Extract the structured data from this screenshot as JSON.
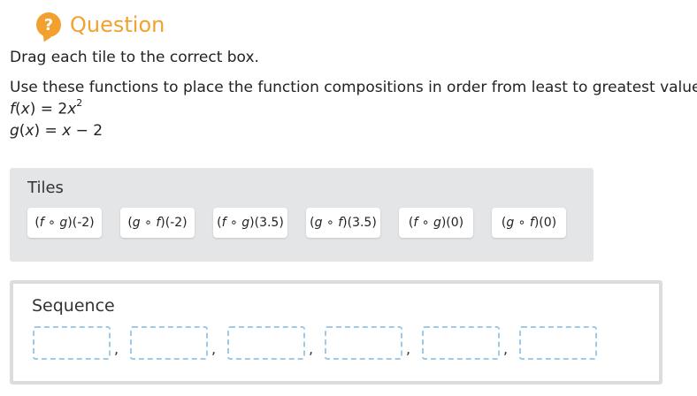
{
  "header": {
    "icon": "question-icon",
    "icon_glyph": "?",
    "title": "Question",
    "accent_color": "#f2a12e"
  },
  "instructions": {
    "drag": "Drag each tile to the correct box.",
    "use": "Use these functions to place the function compositions in order from least to greatest value."
  },
  "functions": {
    "f": {
      "name": "f",
      "var": "x",
      "rhs": "= 2",
      "rhs_var": "x",
      "exp": "2"
    },
    "g": {
      "name": "g",
      "var": "x",
      "rhs_var": "x",
      "rhs_tail": "− 2"
    }
  },
  "tiles": {
    "label": "Tiles",
    "items": [
      {
        "outer": "f",
        "inner": "g",
        "arg": "(-2)"
      },
      {
        "outer": "g",
        "inner": "f",
        "arg": "(-2)"
      },
      {
        "outer": "f",
        "inner": "g",
        "arg": "(3.5)"
      },
      {
        "outer": "g",
        "inner": "f",
        "arg": "(3.5)"
      },
      {
        "outer": "f",
        "inner": "g",
        "arg": "(0)"
      },
      {
        "outer": "g",
        "inner": "f",
        "arg": "(0)"
      }
    ]
  },
  "sequence": {
    "label": "Sequence",
    "separator": ",",
    "slot_count": 6
  },
  "colors": {
    "tiles_bg": "#e4e5e7",
    "slot_border": "#9fcbe8",
    "sequence_border": "#dcdcdc"
  }
}
